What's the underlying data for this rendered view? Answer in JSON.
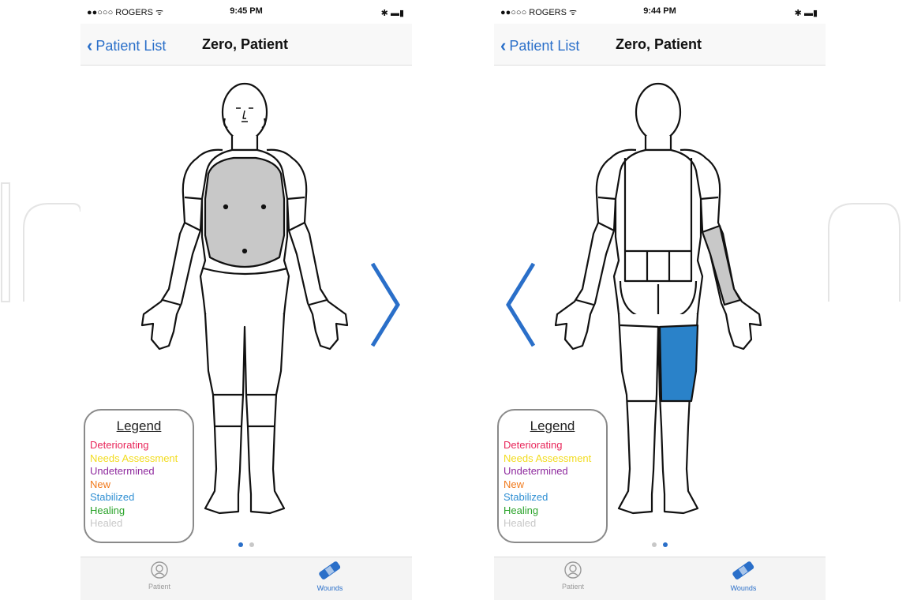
{
  "screens": [
    {
      "status": {
        "carrier": "●●○○○ ROGERS ᯤ",
        "time": "9:45 PM",
        "battery": "✱ ▬▮"
      },
      "nav": {
        "back_label": "Patient List",
        "title": "Zero, Patient"
      },
      "view": "front",
      "arrow": "right",
      "highlight": {
        "chest": "#c8c8c8"
      },
      "page_indicator": {
        "pages": 2,
        "current": 1
      },
      "tabs": [
        {
          "label": "Patient",
          "selected": false
        },
        {
          "label": "Wounds",
          "selected": true
        }
      ]
    },
    {
      "status": {
        "carrier": "●●○○○ ROGERS ᯤ",
        "time": "9:44 PM",
        "battery": "✱ ▬▮"
      },
      "nav": {
        "back_label": "Patient List",
        "title": "Zero, Patient"
      },
      "view": "back",
      "arrow": "left",
      "highlight": {
        "left_forearm": "#c8c8c8",
        "right_thigh": "#2a82c9"
      },
      "page_indicator": {
        "pages": 2,
        "current": 2
      },
      "tabs": [
        {
          "label": "Patient",
          "selected": false
        },
        {
          "label": "Wounds",
          "selected": true
        }
      ]
    }
  ],
  "legend": {
    "title": "Legend",
    "items": [
      {
        "label": "Deteriorating",
        "color": "#e8265a"
      },
      {
        "label": "Needs Assessment",
        "color": "#f2dc1f"
      },
      {
        "label": "Undetermined",
        "color": "#8e2a9e"
      },
      {
        "label": "New",
        "color": "#f07a1c"
      },
      {
        "label": "Stabilized",
        "color": "#2f8fd3"
      },
      {
        "label": "Healing",
        "color": "#2aa32a"
      },
      {
        "label": "Healed",
        "color": "#c8c8c8"
      }
    ]
  },
  "accent_color": "#2a6fc9"
}
